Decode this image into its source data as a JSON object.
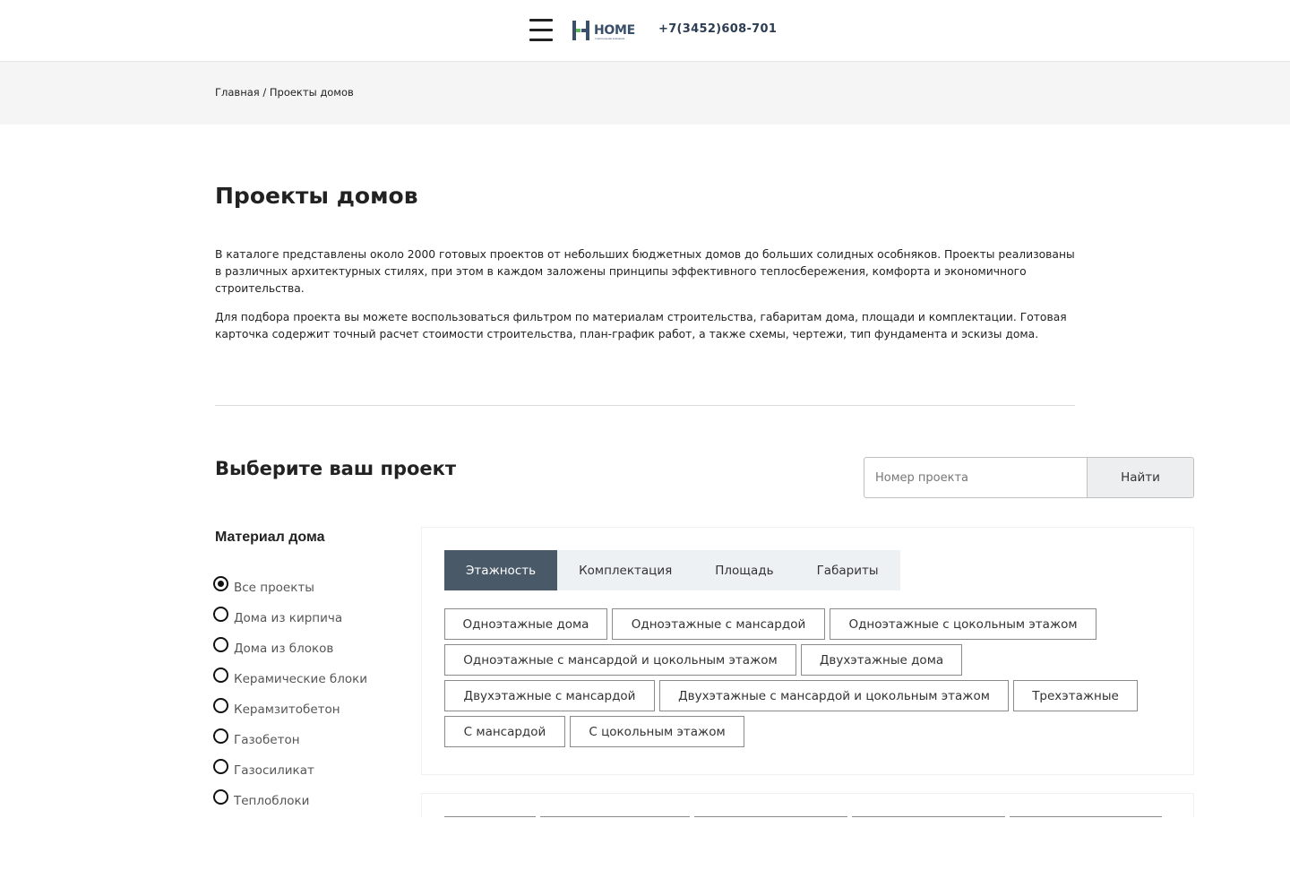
{
  "header": {
    "logo_text": "HOME",
    "logo_sub": "строительная компания",
    "phone": "+7(3452)608-701"
  },
  "breadcrumbs": {
    "home": "Главная",
    "separator": " / ",
    "current": "Проекты домов"
  },
  "page": {
    "title": "Проекты домов",
    "description_1": "В каталоге представлены около 2000 готовых проектов от небольших бюджетных домов до больших солидных особняков. Проекты реализованы в различных архитектурных стилях, при этом в каждом заложены принципы эффективного теплосбережения, комфорта и экономичного строительства.",
    "description_2": "Для подбора проекта вы можете воспользоваться фильтром по материалам строительства, габаритам дома, площади и комплектации. Готовая карточка содержит точный расчет стоимости строительства, план-график работ, а также схемы, чертежи, тип фундамента и эскизы дома."
  },
  "select": {
    "title": "Выберите ваш проект",
    "search_placeholder": "Номер проекта",
    "search_button": "Найти"
  },
  "material_filter": {
    "title": "Материал дома",
    "options": [
      {
        "label": "Все проекты",
        "checked": true
      },
      {
        "label": "Дома из кирпича",
        "checked": false
      },
      {
        "label": "Дома из блоков",
        "checked": false
      },
      {
        "label": "Керамические блоки",
        "checked": false
      },
      {
        "label": "Керамзитобетон",
        "checked": false
      },
      {
        "label": "Газобетон",
        "checked": false
      },
      {
        "label": "Газосиликат",
        "checked": false
      },
      {
        "label": "Теплоблоки",
        "checked": false
      }
    ]
  },
  "tabs": [
    {
      "label": "Этажность",
      "active": true
    },
    {
      "label": "Комплектация",
      "active": false
    },
    {
      "label": "Площадь",
      "active": false
    },
    {
      "label": "Габариты",
      "active": false
    }
  ],
  "floor_options": [
    "Одноэтажные дома",
    "Одноэтажные с мансардой",
    "Одноэтажные с цокольным этажом",
    "Одноэтажные с мансардой и цокольным этажом",
    "Двухэтажные дома",
    "Двухэтажные с мансардой",
    "Двухэтажные с мансардой и цокольным этажом",
    "Трехэтажные",
    "С мансардой",
    "С цокольным этажом"
  ],
  "colors": {
    "active_tab_bg": "#4a5968",
    "tabs_bg": "#eef1f3",
    "breadcrumb_band": "#f5f5f5",
    "logo_green": "#5cb85c",
    "logo_blue": "#3a4f6a"
  }
}
